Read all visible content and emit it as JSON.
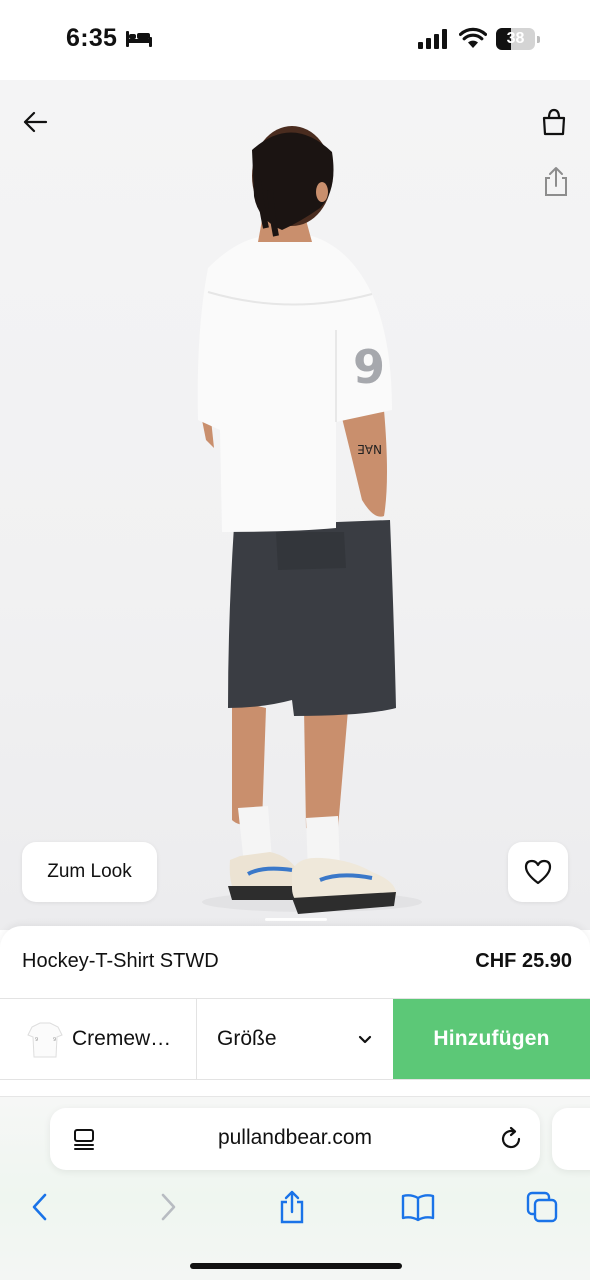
{
  "status_bar": {
    "time": "6:35",
    "battery_level": "38",
    "battery_fraction": 0.38
  },
  "product": {
    "name": "Hockey-T-Shirt STWD",
    "price": "CHF 25.90",
    "jersey_number": "9",
    "tattoo_text": "NAE"
  },
  "image_controls": {
    "look_button_label": "Zum Look",
    "icons": [
      "back-arrow-icon",
      "shopping-bag-icon",
      "share-icon",
      "heart-icon"
    ]
  },
  "purchase_bar": {
    "color_label": "Cremew…",
    "size_label": "Größe",
    "add_label": "Hinzufügen",
    "add_button_color": "#5cc877"
  },
  "browser": {
    "url": "pullandbear.com",
    "toolbar_icons": [
      "back-icon",
      "forward-icon",
      "share-icon",
      "bookmarks-icon",
      "tabs-icon"
    ],
    "accent_color": "#1a73e8"
  }
}
